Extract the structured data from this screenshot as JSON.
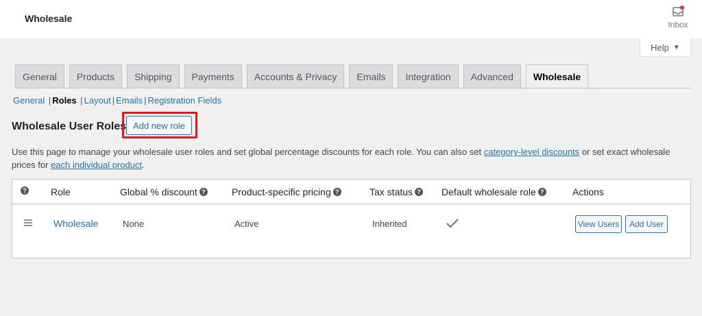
{
  "header": {
    "title": "Wholesale",
    "inbox_label": "Inbox",
    "help_label": "Help"
  },
  "tabs": [
    {
      "label": "General"
    },
    {
      "label": "Products"
    },
    {
      "label": "Shipping"
    },
    {
      "label": "Payments"
    },
    {
      "label": "Accounts & Privacy"
    },
    {
      "label": "Emails"
    },
    {
      "label": "Integration"
    },
    {
      "label": "Advanced"
    },
    {
      "label": "Wholesale",
      "active": true
    }
  ],
  "subnav": [
    {
      "label": "General"
    },
    {
      "label": "Roles",
      "current": true
    },
    {
      "label": "Layout"
    },
    {
      "label": "Emails"
    },
    {
      "label": "Registration Fields"
    }
  ],
  "page": {
    "heading": "Wholesale User Roles",
    "add_role_label": "Add new role",
    "desc_part1": "Use this page to manage your wholesale user roles and set global percentage discounts for each role. You can also set ",
    "desc_link1": "category-level discounts",
    "desc_part2": " or set exact wholesale prices for ",
    "desc_link2": "each individual product",
    "desc_part3": "."
  },
  "table": {
    "headers": {
      "role": "Role",
      "discount": "Global % discount",
      "pricing": "Product-specific pricing",
      "tax": "Tax status",
      "default": "Default wholesale role",
      "actions": "Actions"
    },
    "rows": [
      {
        "role": "Wholesale",
        "discount": "None",
        "pricing": "Active",
        "tax": "Inherited",
        "default": true,
        "view_users_label": "View Users",
        "add_user_label": "Add User"
      }
    ]
  },
  "colors": {
    "accent": "#2271b1",
    "highlight": "#e0181c",
    "check": "#8a5a9e"
  }
}
